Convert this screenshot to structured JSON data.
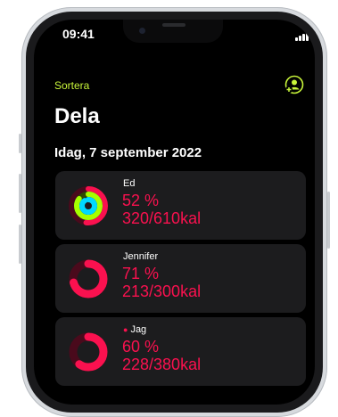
{
  "status_bar": {
    "time": "09:41"
  },
  "nav": {
    "sort_label": "Sortera",
    "share_icon": "person-add-icon"
  },
  "page": {
    "title": "Dela",
    "date_header": "Idag, 7 september 2022"
  },
  "colors": {
    "move": "#fa114f",
    "exercise": "#a6ff00",
    "stand": "#00d9ff",
    "accent": "#c8f53a"
  },
  "friends": [
    {
      "name": "Ed",
      "percent": "52 %",
      "kcal": "320/610kal",
      "move_progress": 0.52,
      "exercise_progress": 0.85,
      "stand_progress": 0.9
    },
    {
      "name": "Jennifer",
      "percent": "71 %",
      "kcal": "213/300kal",
      "move_progress": 0.71
    },
    {
      "name": "Jag",
      "percent": "60 %",
      "kcal": "228/380kal",
      "move_progress": 0.6
    }
  ]
}
